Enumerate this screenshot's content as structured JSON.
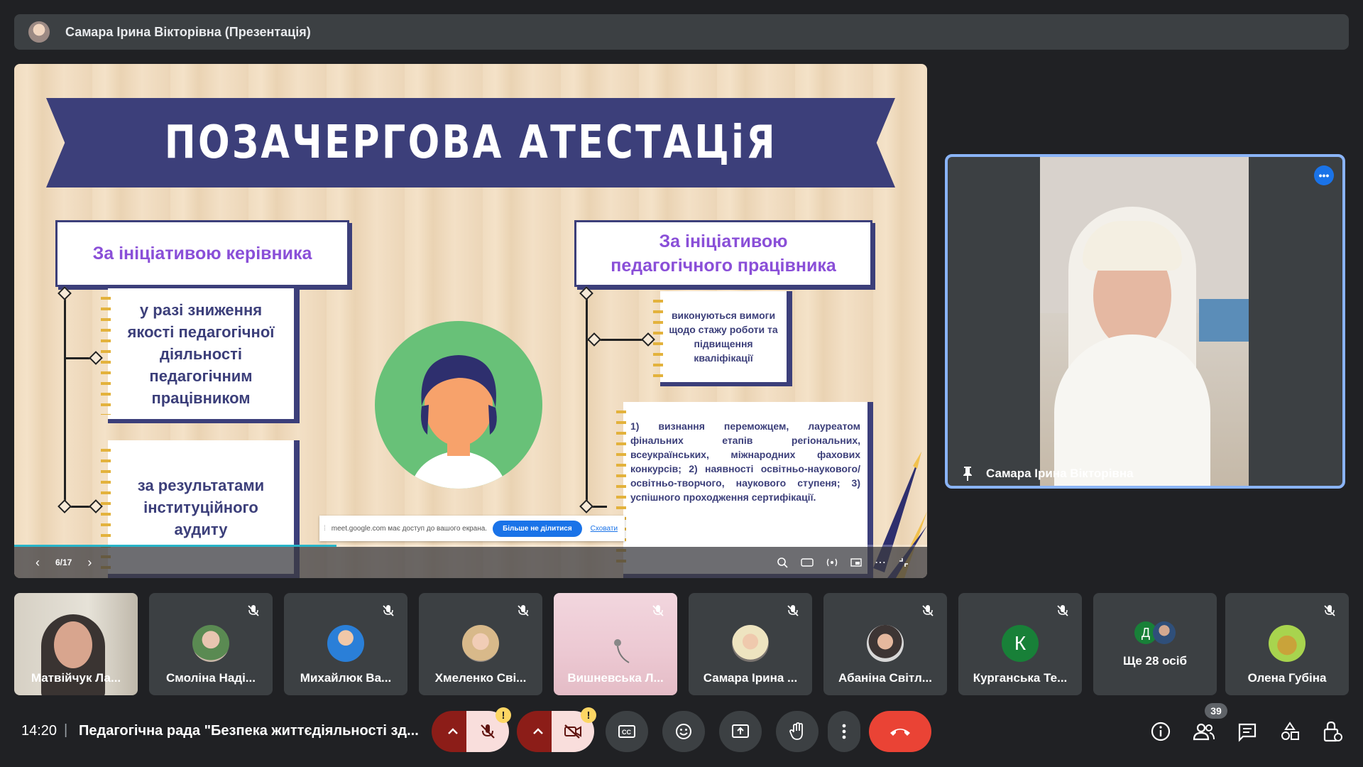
{
  "topbar": {
    "title": "Самара Ірина Вікторівна (Презентація)"
  },
  "slide": {
    "heading": "ПОЗАЧЕРГОВА АТЕСТАЦіЯ",
    "left_header": "За ініціативою керівника",
    "left_card_1": "у разі зниження якості педагогічної діяльності педагогічним працівником",
    "left_card_2": "за результатами інституційного аудиту",
    "right_header_1": "За ініціативою",
    "right_header_2": "педагогічного працівника",
    "right_card_1": "виконуються вимоги щодо стажу роботи та підвищення кваліфікації",
    "right_card_2": "1) визнання переможцем, лауреатом фінальних етапів регіональних, всеукраїнських, міжнародних фахових конкурсів; 2) наявності освітньо-наукового/ освітньо-творчого, наукового ступеня; 3) успішного проходження сертифікації."
  },
  "slide_controls": {
    "page": "6/17",
    "progress": 0.353
  },
  "share_notice": {
    "text": "meet.google.com має доступ до вашого екрана.",
    "stop": "Більше не ділитися",
    "hide": "Сховати"
  },
  "presenter": {
    "name": "Самара Ірина Вікторівна"
  },
  "participants": [
    {
      "name": "Матвійчук Ла..."
    },
    {
      "name": "Смоліна Наді..."
    },
    {
      "name": "Михайлюк Ва..."
    },
    {
      "name": "Хмеленко Сві..."
    },
    {
      "name": "Вишневська Л..."
    },
    {
      "name": "Самара Ірина ..."
    },
    {
      "name": "Абаніна Світл..."
    },
    {
      "name": "Курганська Те...",
      "initial": "К"
    },
    {
      "name": "Ще 28 осіб",
      "initial": "Д"
    },
    {
      "name": "Олена Губіна"
    }
  ],
  "bottombar": {
    "time": "14:20",
    "separator": "|",
    "meeting_title": "Педагогічна рада \"Безпека життєдіяльності зд...",
    "participants_count": "39",
    "warning": "!"
  },
  "colors": {
    "navy": "#3c3f7a",
    "purple": "#8a4fd8",
    "end_call": "#ea4335",
    "muted": "#f9dedc",
    "accent": "#8ab4f8"
  }
}
